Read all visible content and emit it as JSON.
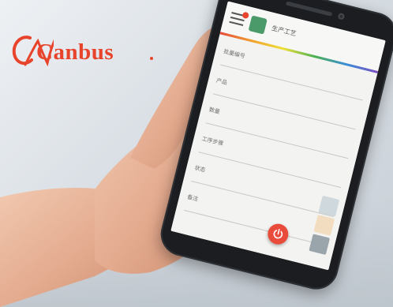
{
  "logo": {
    "brand": "Canbus",
    "mark": "CN",
    "color": "#e8442c"
  },
  "scene": {
    "subject": "hand holding smartphone",
    "background_color": "#d9dee3"
  },
  "app": {
    "title": "生产工艺",
    "fields": [
      {
        "label": "批量编号"
      },
      {
        "label": "产品"
      },
      {
        "label": "数量"
      },
      {
        "label": "工序步骤"
      },
      {
        "label": "状态",
        "has_dropdown": true
      },
      {
        "label": "备注"
      }
    ],
    "icons": [
      "menu-icon",
      "app-icon",
      "tool-icon",
      "back-icon",
      "up-icon",
      "power-icon"
    ],
    "colors": {
      "accent": "#ea4c3c",
      "app_icon": "#4b9a6a"
    }
  }
}
